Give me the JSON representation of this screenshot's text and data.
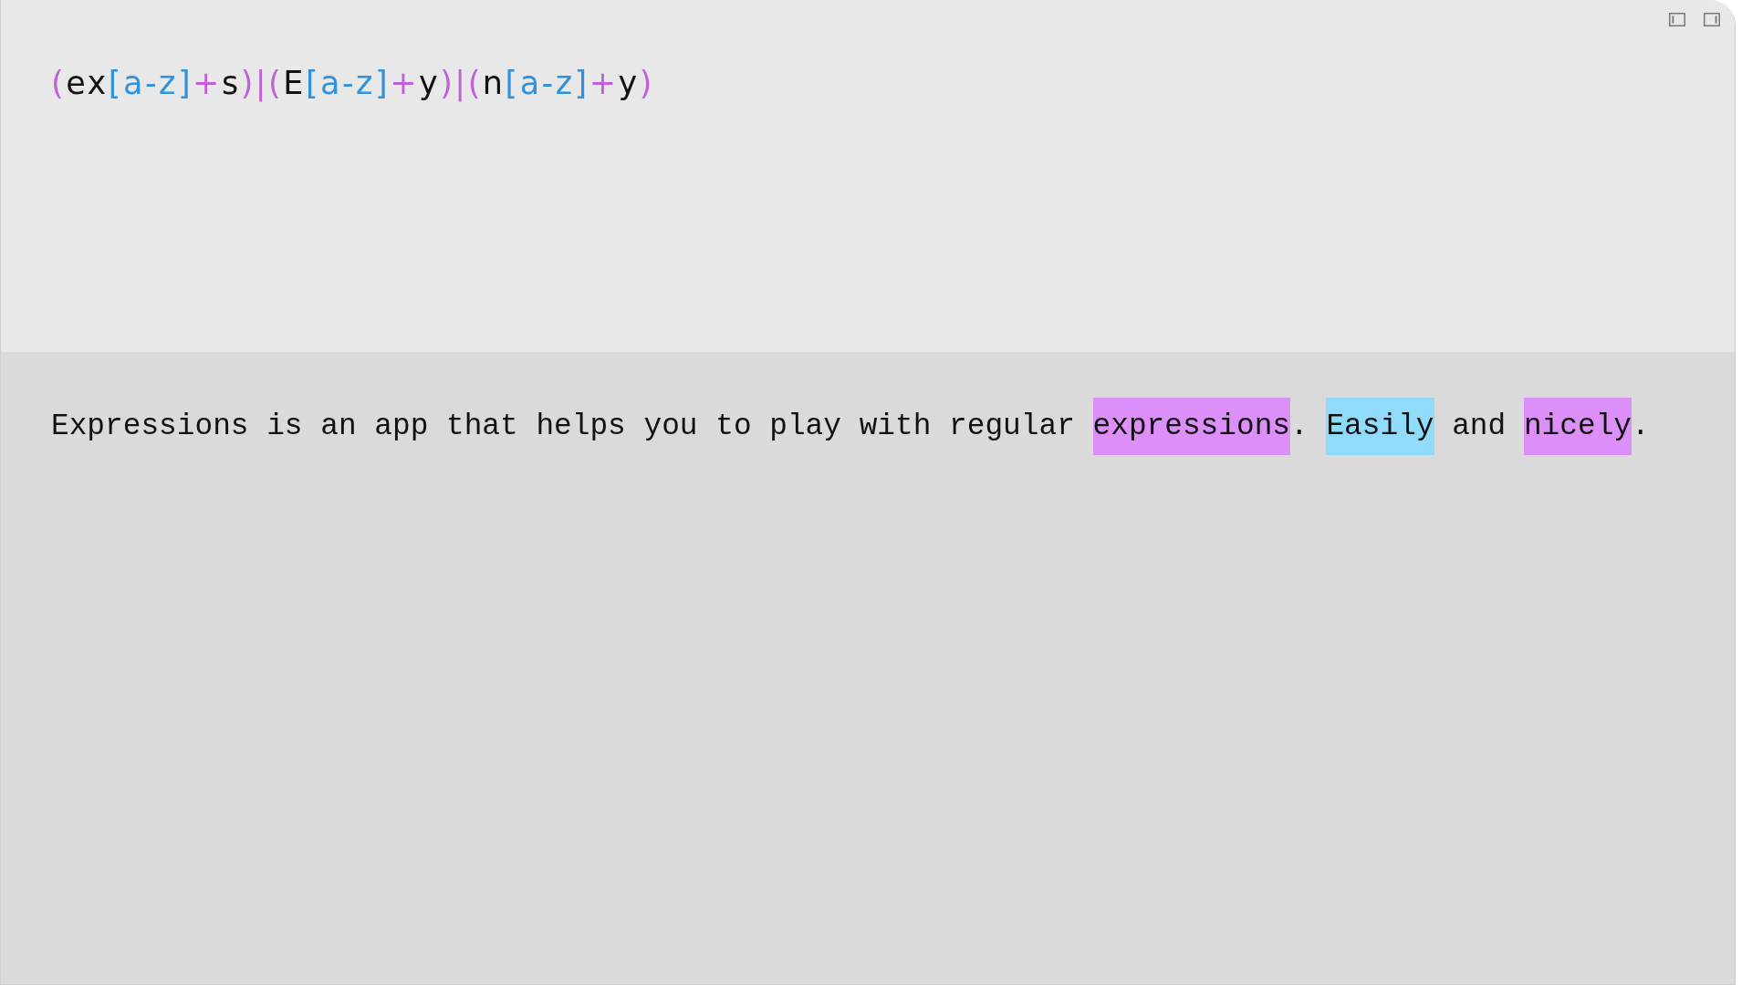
{
  "toolbar": {
    "buttons": [
      {
        "kind": "left-sidebar"
      },
      {
        "kind": "right-sidebar"
      }
    ]
  },
  "pattern": {
    "tokens": [
      {
        "text": "(",
        "kind": "group"
      },
      {
        "text": "ex",
        "kind": "literal"
      },
      {
        "text": "[a-z]",
        "kind": "class"
      },
      {
        "text": "+",
        "kind": "quantifier"
      },
      {
        "text": "s",
        "kind": "literal"
      },
      {
        "text": ")",
        "kind": "group"
      },
      {
        "text": "|",
        "kind": "alternation"
      },
      {
        "text": "(",
        "kind": "group"
      },
      {
        "text": "E",
        "kind": "literal"
      },
      {
        "text": "[a-z]",
        "kind": "class"
      },
      {
        "text": "+",
        "kind": "quantifier"
      },
      {
        "text": "y",
        "kind": "literal"
      },
      {
        "text": ")",
        "kind": "group"
      },
      {
        "text": "|",
        "kind": "alternation"
      },
      {
        "text": "(",
        "kind": "group"
      },
      {
        "text": "n",
        "kind": "literal"
      },
      {
        "text": "[a-z]",
        "kind": "class"
      },
      {
        "text": "+",
        "kind": "quantifier"
      },
      {
        "text": "y",
        "kind": "literal"
      },
      {
        "text": ")",
        "kind": "group"
      }
    ]
  },
  "sample": {
    "segments": [
      {
        "text": "Expressions is an app that helps you to play with regular "
      },
      {
        "text": "expressions",
        "color": "#dd8ff9"
      },
      {
        "text": ". "
      },
      {
        "text": "Easily",
        "color": "#8fdbf9"
      },
      {
        "text": " and "
      },
      {
        "text": "nicely",
        "color": "#dd8ff9"
      },
      {
        "text": "."
      }
    ]
  }
}
